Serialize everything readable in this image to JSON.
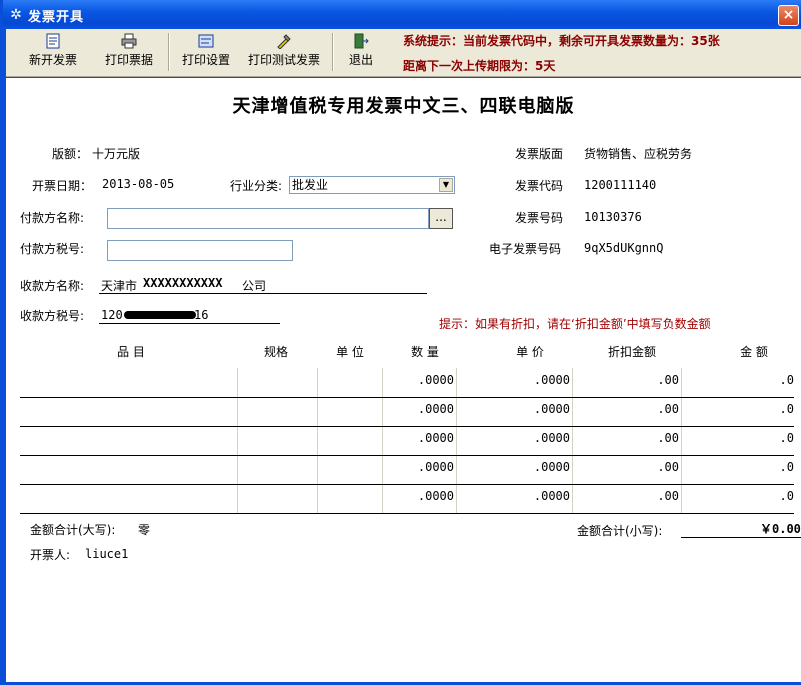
{
  "window": {
    "title": "发票开具",
    "close_symbol": "×"
  },
  "toolbar": {
    "buttons": [
      {
        "label": "新开发票",
        "icon": "new-invoice-icon"
      },
      {
        "label": "打印票据",
        "icon": "printer-icon"
      },
      {
        "label": "打印设置",
        "icon": "print-settings-icon"
      },
      {
        "label": "打印测试发票",
        "icon": "print-test-icon"
      },
      {
        "label": "退出",
        "icon": "exit-icon"
      }
    ],
    "system_notice_line1": "系统提示：当前发票代码中，剩余可开具发票数量为：35张",
    "system_notice_line2": "距离下一次上传期限为：5天"
  },
  "form": {
    "title": "天津增值税专用发票中文三、四联电脑版",
    "edition_label": "版额：",
    "edition_value": "十万元版",
    "invoice_face_label": "发票版面",
    "invoice_face_value": "货物销售、应税劳务",
    "date_label": "开票日期：",
    "date_value": "2013-08-05",
    "industry_label": "行业分类:",
    "industry_value": "批发业",
    "invoice_code_label": "发票代码",
    "invoice_code_value": "1200111140",
    "payer_name_label": "付款方名称:",
    "payer_name_value": "",
    "ellipsis": "...",
    "invoice_number_label": "发票号码",
    "invoice_number_value": "10130376",
    "payer_tax_label": "付款方税号:",
    "payer_tax_value": "",
    "e_invoice_label": "电子发票号码",
    "e_invoice_value": "9qX5dUKgnnQ",
    "payee_name_label": "收款方名称:",
    "payee_name_value_prefix": "天津市",
    "payee_name_value_masked": "XXXXXXXXXXX",
    "payee_name_value_suffix": "公司",
    "payee_tax_label": "收款方税号:",
    "payee_tax_value_prefix": "120",
    "payee_tax_value_suffix": "16",
    "discount_hint": "提示：如果有折扣，请在‘折扣金额’中填写负数金额"
  },
  "table": {
    "headers": [
      "品  目",
      "规格",
      "单  位",
      "数  量",
      "单  价",
      "折扣金额",
      "金  额"
    ],
    "rows": [
      {
        "quantity": ".0000",
        "unit_price": ".0000",
        "discount": ".00",
        "amount": ".0"
      },
      {
        "quantity": ".0000",
        "unit_price": ".0000",
        "discount": ".00",
        "amount": ".0"
      },
      {
        "quantity": ".0000",
        "unit_price": ".0000",
        "discount": ".00",
        "amount": ".0"
      },
      {
        "quantity": ".0000",
        "unit_price": ".0000",
        "discount": ".00",
        "amount": ".0"
      },
      {
        "quantity": ".0000",
        "unit_price": ".0000",
        "discount": ".00",
        "amount": ".0"
      }
    ]
  },
  "totals": {
    "total_upper_label": "金额合计(大写):",
    "total_upper_value": "零",
    "total_lower_label": "金额合计(小写):",
    "total_lower_value": "￥0.00",
    "issuer_label": "开票人:",
    "issuer_value": "liuce1"
  }
}
